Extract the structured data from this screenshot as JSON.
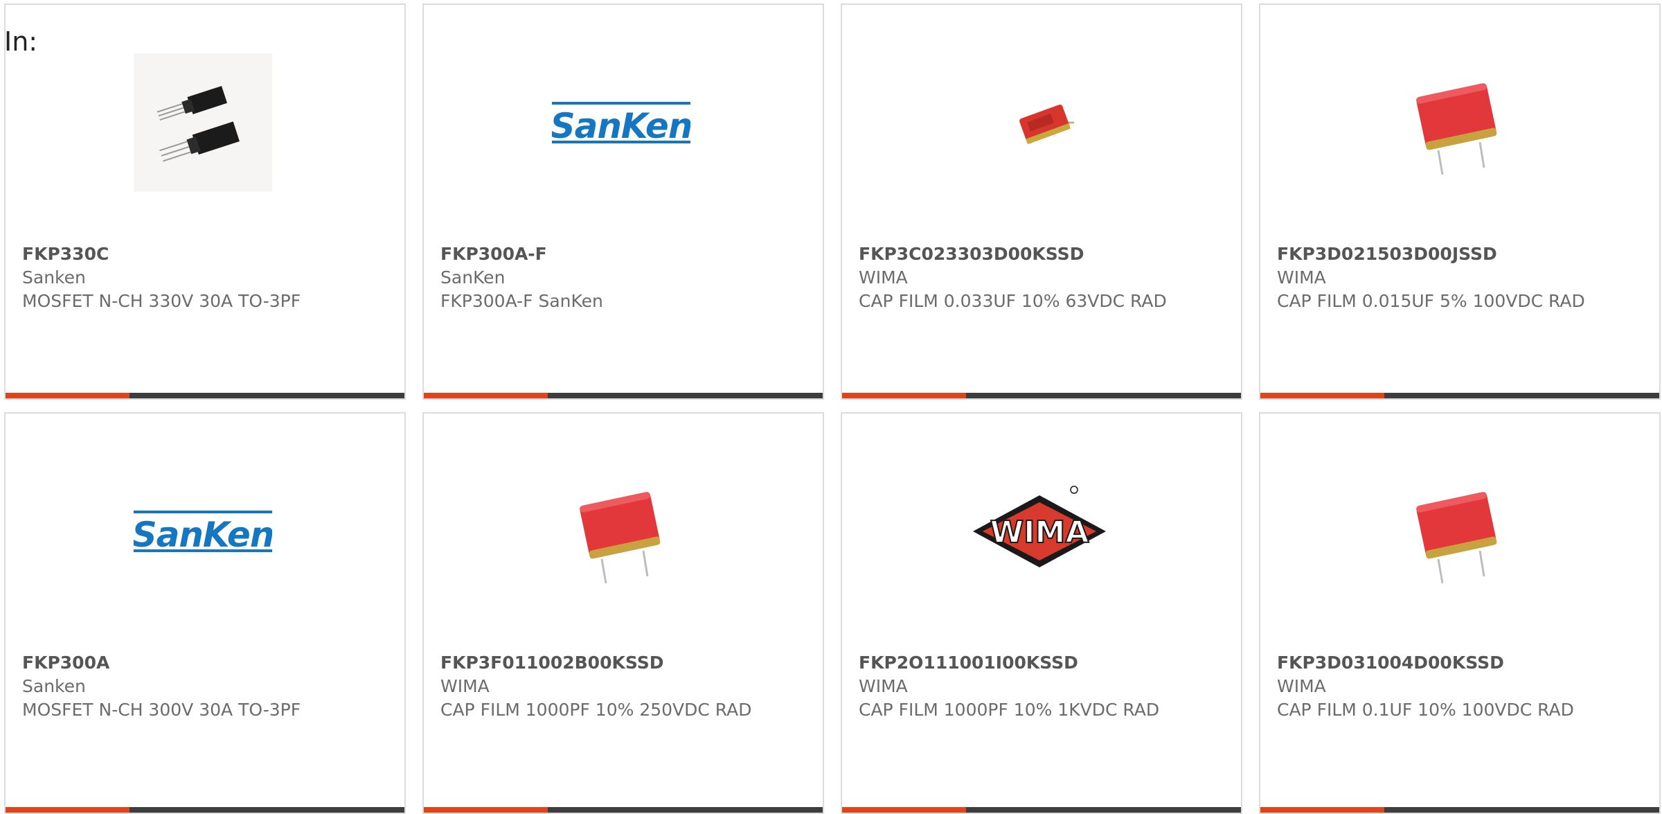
{
  "page": {
    "in_label": "In:"
  },
  "colors": {
    "accent": "#e2431b",
    "bar": "#3d3d3d",
    "sanken_blue": "#1577c2",
    "wima_red": "#d83a2e"
  },
  "cards": [
    {
      "part": "FKP330C",
      "maker": "Sanken",
      "desc": "MOSFET N-CH 330V 30A TO-3PF",
      "image": "transistor-photo",
      "progress": 0.31
    },
    {
      "part": "FKP300A-F",
      "maker": "SanKen",
      "desc": "FKP300A-F SanKen",
      "image": "sanken-logo",
      "logo_text": "SanKen",
      "progress": 0.31
    },
    {
      "part": "FKP3C023303D00KSSD",
      "maker": "WIMA",
      "desc": "CAP FILM 0.033UF 10% 63VDC RAD",
      "image": "small-capacitor-photo",
      "progress": 0.31
    },
    {
      "part": "FKP3D021503D00JSSD",
      "maker": "WIMA",
      "desc": "CAP FILM 0.015UF 5% 100VDC RAD",
      "image": "capacitor-photo",
      "progress": 0.31
    },
    {
      "part": "FKP300A",
      "maker": "Sanken",
      "desc": "MOSFET N-CH 300V 30A TO-3PF",
      "image": "sanken-logo",
      "logo_text": "SanKen",
      "progress": 0.31
    },
    {
      "part": "FKP3F011002B00KSSD",
      "maker": "WIMA",
      "desc": "CAP FILM 1000PF 10% 250VDC RAD",
      "image": "capacitor-photo",
      "progress": 0.31
    },
    {
      "part": "FKP2O111001I00KSSD",
      "maker": "WIMA",
      "desc": "CAP FILM 1000PF 10% 1KVDC RAD",
      "image": "wima-logo",
      "logo_text": "WIMA",
      "progress": 0.31
    },
    {
      "part": "FKP3D031004D00KSSD",
      "maker": "WIMA",
      "desc": "CAP FILM 0.1UF 10% 100VDC RAD",
      "image": "capacitor-photo",
      "progress": 0.31
    }
  ]
}
